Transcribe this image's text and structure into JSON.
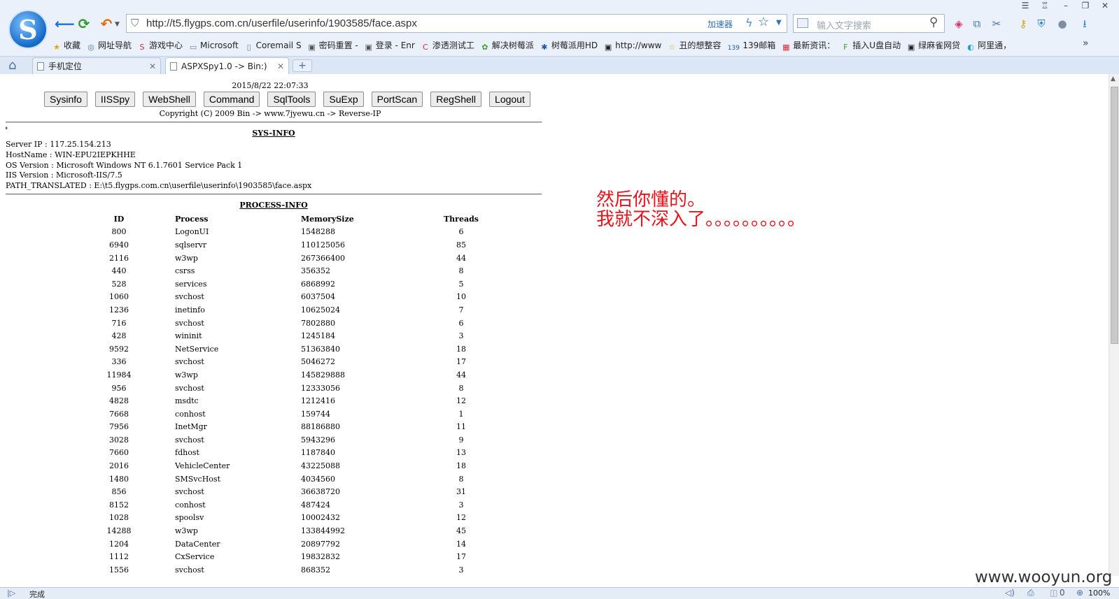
{
  "browser": {
    "logo_letter": "S",
    "address_url": "http://t5.flygps.com.cn/userfile/userinfo/1903585/face.aspx",
    "accelerator_label": "加速器",
    "search_placeholder": "输入文字搜索",
    "bookmarks": [
      {
        "icon": "star-icon",
        "glyph": "★",
        "color": "#e3a40c",
        "label": "收藏"
      },
      {
        "icon": "globe-icon",
        "glyph": "◎",
        "color": "#4f74a6",
        "label": "网址导航"
      },
      {
        "icon": "game-icon",
        "glyph": "S",
        "color": "#d9282e",
        "label": "游戏中心"
      },
      {
        "icon": "folder-icon",
        "glyph": "▭",
        "color": "#6b7f99",
        "label": "Microsoft"
      },
      {
        "icon": "page-icon",
        "glyph": "▯",
        "color": "#6b7f99",
        "label": "Coremail S"
      },
      {
        "icon": "page-icon",
        "glyph": "▣",
        "color": "#555555",
        "label": "密码重置 -"
      },
      {
        "icon": "page-icon",
        "glyph": "▣",
        "color": "#555555",
        "label": "登录 - Enr"
      },
      {
        "icon": "c-icon",
        "glyph": "C",
        "color": "#d9282e",
        "label": "渗透测试工"
      },
      {
        "icon": "plant-icon",
        "glyph": "✿",
        "color": "#3a9a3a",
        "label": "解决树莓派"
      },
      {
        "icon": "paw-icon",
        "glyph": "✱",
        "color": "#1f56b0",
        "label": "树莓派用HD"
      },
      {
        "icon": "page-icon",
        "glyph": "▣",
        "color": "#222222",
        "label": "http://www"
      },
      {
        "icon": "star-icon",
        "glyph": "☆",
        "color": "#e3a40c",
        "label": "丑的想整容"
      },
      {
        "icon": "mail-icon",
        "glyph": "139",
        "color": "#1f56b0",
        "label": "139邮箱"
      },
      {
        "icon": "news-icon",
        "glyph": "▦",
        "color": "#d9282e",
        "label": "最新资讯："
      },
      {
        "icon": "f-icon",
        "glyph": "F",
        "color": "#3a9a3a",
        "label": "插入U盘自动"
      },
      {
        "icon": "page-icon",
        "glyph": "▣",
        "color": "#222222",
        "label": "绿麻雀网贷"
      },
      {
        "icon": "cloud-icon",
        "glyph": "◐",
        "color": "#1aa5d6",
        "label": "阿里通，"
      }
    ],
    "tabs": [
      {
        "label": "手机定位",
        "active": false
      },
      {
        "label": "ASPXSpy1.0 -> Bin:)",
        "active": true
      }
    ],
    "status_text": "完成",
    "zoom": "100%",
    "download_count": "0"
  },
  "page": {
    "datetime": "2015/8/22 22:07:33",
    "menu": [
      "Sysinfo",
      "IISSpy",
      "WebShell",
      "Command",
      "SqlTools",
      "SuExp",
      "PortScan",
      "RegShell",
      "Logout"
    ],
    "copyright": "Copyright (C) 2009 Bin -> www.7jyewu.cn -> Reverse-IP",
    "sys_title": "SYS-INFO",
    "sysinfo_lines": [
      "Server IP : 117.25.154.213",
      "HostName : WIN-EPU2IEPKHHE",
      "OS Version : Microsoft Windows NT 6.1.7601 Service Pack 1",
      "IIS Version : Microsoft-IIS/7.5",
      "PATH_TRANSLATED : E:\\t5.flygps.com.cn\\userfile\\userinfo\\1903585\\face.aspx"
    ],
    "proc_title": "PROCESS-INFO",
    "proc_headers": [
      "ID",
      "Process",
      "MemorySize",
      "Threads"
    ],
    "processes": [
      [
        "800",
        "LogonUI",
        "1548288",
        "6"
      ],
      [
        "6940",
        "sqlservr",
        "110125056",
        "85"
      ],
      [
        "2116",
        "w3wp",
        "267366400",
        "44"
      ],
      [
        "440",
        "csrss",
        "356352",
        "8"
      ],
      [
        "528",
        "services",
        "6868992",
        "5"
      ],
      [
        "1060",
        "svchost",
        "6037504",
        "10"
      ],
      [
        "1236",
        "inetinfo",
        "10625024",
        "7"
      ],
      [
        "716",
        "svchost",
        "7802880",
        "6"
      ],
      [
        "428",
        "wininit",
        "1245184",
        "3"
      ],
      [
        "9592",
        "NetService",
        "51363840",
        "18"
      ],
      [
        "336",
        "svchost",
        "5046272",
        "17"
      ],
      [
        "11984",
        "w3wp",
        "145829888",
        "44"
      ],
      [
        "956",
        "svchost",
        "12333056",
        "8"
      ],
      [
        "4828",
        "msdtc",
        "1212416",
        "12"
      ],
      [
        "7668",
        "conhost",
        "159744",
        "1"
      ],
      [
        "7956",
        "InetMgr",
        "88186880",
        "11"
      ],
      [
        "3028",
        "svchost",
        "5943296",
        "9"
      ],
      [
        "7660",
        "fdhost",
        "1187840",
        "13"
      ],
      [
        "2016",
        "VehicleCenter",
        "43225088",
        "18"
      ],
      [
        "1480",
        "SMSvcHost",
        "4034560",
        "8"
      ],
      [
        "856",
        "svchost",
        "36638720",
        "31"
      ],
      [
        "8152",
        "conhost",
        "487424",
        "3"
      ],
      [
        "1028",
        "spoolsv",
        "10002432",
        "12"
      ],
      [
        "14288",
        "w3wp",
        "133844992",
        "45"
      ],
      [
        "1204",
        "DataCenter",
        "20897792",
        "14"
      ],
      [
        "1112",
        "CxService",
        "19832832",
        "17"
      ],
      [
        "1556",
        "svchost",
        "868352",
        "3"
      ]
    ]
  },
  "annotation": "然后你懂的。\n我就不深入了。。。。。。。。。。",
  "watermark": "www.wooyun.org"
}
